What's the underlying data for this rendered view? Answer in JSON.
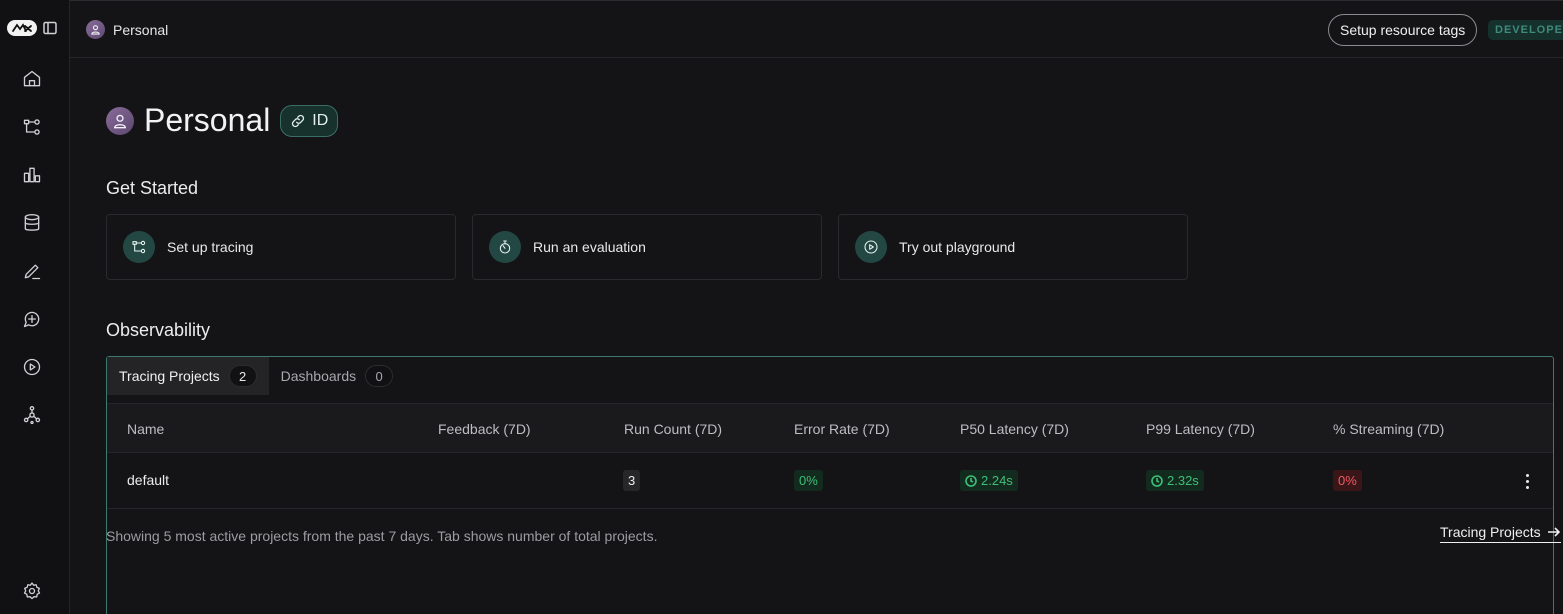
{
  "breadcrumb": {
    "label": "Personal"
  },
  "header": {
    "setup_tags": "Setup resource tags",
    "badge": "DEVELOPER"
  },
  "workspace": {
    "title": "Personal",
    "id_chip": "ID"
  },
  "get_started": {
    "title": "Get Started",
    "cards": [
      {
        "label": "Set up tracing",
        "icon": "tracing-icon"
      },
      {
        "label": "Run an evaluation",
        "icon": "stopwatch-icon"
      },
      {
        "label": "Try out playground",
        "icon": "play-circle-icon"
      }
    ]
  },
  "observability": {
    "title": "Observability",
    "tabs": [
      {
        "label": "Tracing Projects",
        "count": "2"
      },
      {
        "label": "Dashboards",
        "count": "0"
      }
    ],
    "columns": [
      "Name",
      "Feedback (7D)",
      "Run Count (7D)",
      "Error Rate (7D)",
      "P50 Latency (7D)",
      "P99 Latency (7D)",
      "% Streaming (7D)"
    ],
    "rows": [
      {
        "name": "default",
        "feedback": "",
        "run_count": "3",
        "error_rate": "0%",
        "p50": "2.24s",
        "p99": "2.32s",
        "streaming": "0%"
      }
    ],
    "footer_note": "Showing 5 most active projects from the past 7 days. Tab shows number of total projects.",
    "link": "Tracing Projects"
  },
  "colors": {
    "accent": "#3c7a71",
    "success": "#3fbf78",
    "danger": "#f05b62"
  }
}
